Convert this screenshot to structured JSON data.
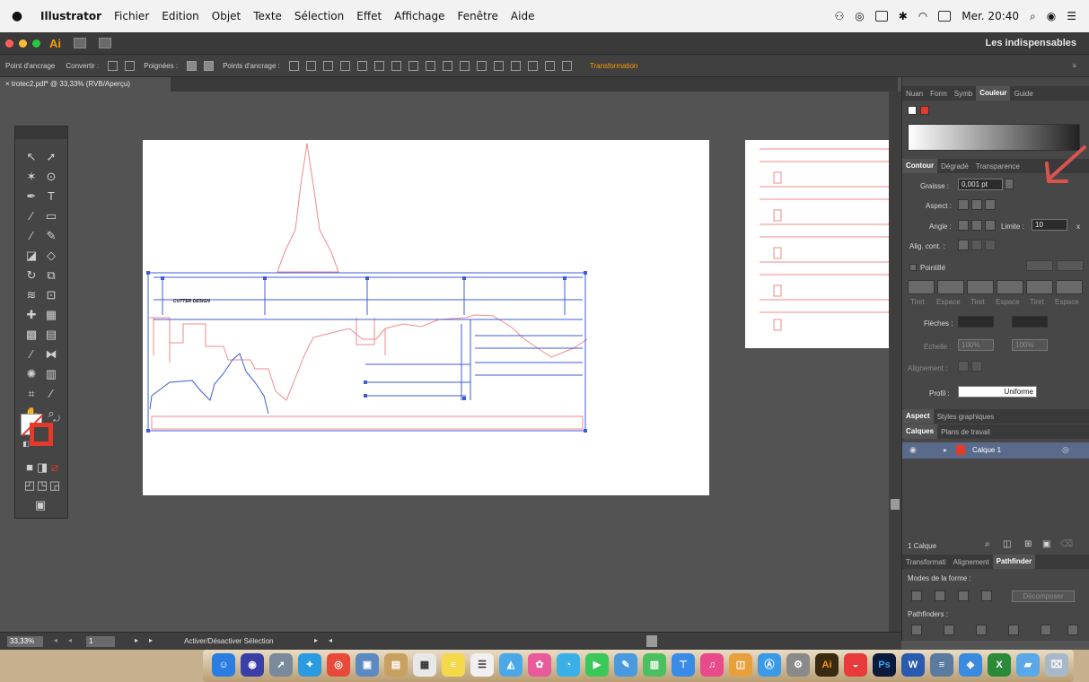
{
  "menubar": {
    "app": "Illustrator",
    "items": [
      "Fichier",
      "Edition",
      "Objet",
      "Texte",
      "Sélection",
      "Effet",
      "Affichage",
      "Fenêtre",
      "Aide"
    ],
    "clock": "Mer. 20:40"
  },
  "appbar": {
    "logo": "Ai",
    "workspace": "Les indispensables"
  },
  "ctrlbar": {
    "anchor_point": "Point d'ancrage",
    "convert": "Convertir :",
    "handles": "Poignées :",
    "anchor_points": "Points d'ancrage :",
    "transform": "Transformation"
  },
  "document": {
    "tab_title": "trotec2.pdf* @ 33,33% (RVB/Aperçu)",
    "artwork_label": "CUTTER DESIGN"
  },
  "color_panel": {
    "tabs": [
      "Nuan",
      "Form",
      "Symb",
      "Couleur",
      "Guide"
    ],
    "active_tab": "Couleur"
  },
  "stroke_panel": {
    "tabs": [
      "Contour",
      "Dégradé",
      "Transparence"
    ],
    "active_tab": "Contour",
    "weight_label": "Graisse :",
    "weight_value": "0,001 pt",
    "cap_label": "Aspect :",
    "corner_label": "Angle :",
    "limit_label": "Limite :",
    "limit_value": "10",
    "limit_unit": "x",
    "align_label": "Alig. cont. :",
    "dashed_label": "Pointillé",
    "dash_labels": [
      "Tiret",
      "Espace",
      "Tiret",
      "Espace",
      "Tiret",
      "Espace"
    ],
    "arrows_label": "Flèches :",
    "scale_label": "Échelle :",
    "scale_values": [
      "100%",
      "100%"
    ],
    "alignment_label": "Alignement :",
    "profile_label": "Profil :",
    "profile_value": "Uniforme"
  },
  "appearance_panel": {
    "tabs": [
      "Aspect",
      "Styles graphiques"
    ]
  },
  "layers_panel": {
    "tabs": [
      "Calques",
      "Plans de travail"
    ],
    "layer_name": "Calque 1",
    "footer_count": "1 Calque"
  },
  "pathfinder_panel": {
    "tabs": [
      "Transformati",
      "Alignement",
      "Pathfinder"
    ],
    "shape_modes_label": "Modes de la forme :",
    "expand_label": "Décomposer",
    "pathfinders_label": "Pathfinders :"
  },
  "statusbar": {
    "zoom": "33,33%",
    "page": "1",
    "selection_tool": "Activer/Désactiver Sélection"
  },
  "colors": {
    "accent_orange": "#ff9a00",
    "stroke_red": "#e53a2a",
    "arrow_annotation": "#d9534f",
    "selection_blue": "#3d5bd9",
    "cut_line_red": "#f08a8a"
  }
}
